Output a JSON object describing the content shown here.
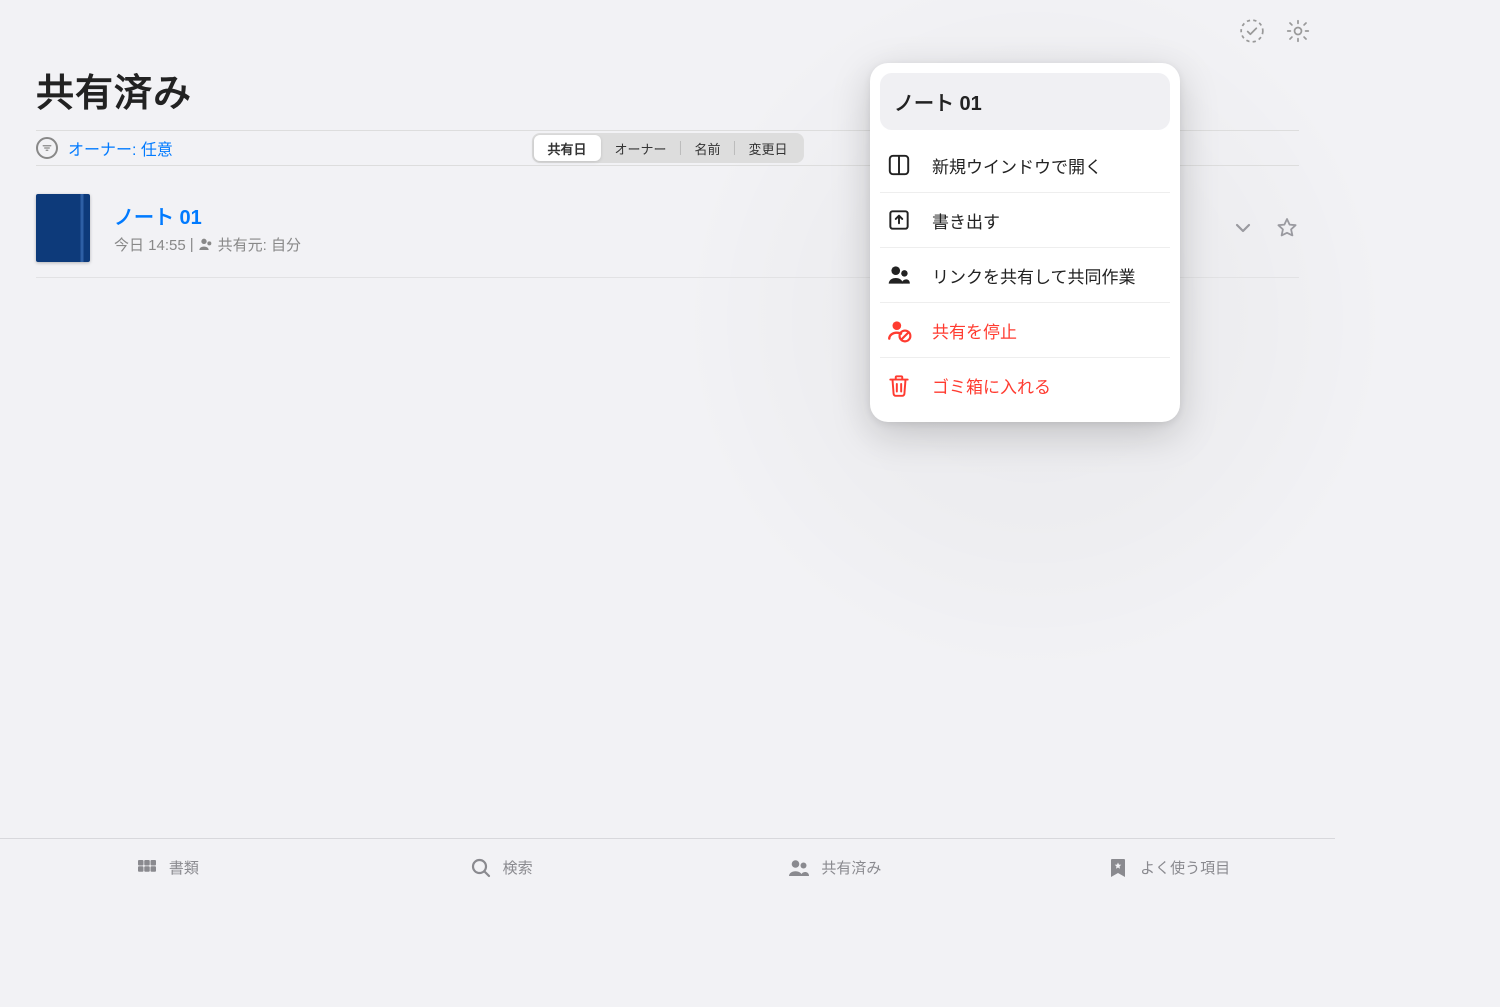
{
  "header": {
    "title": "共有済み"
  },
  "filter": {
    "owner_label": "オーナー: 任意"
  },
  "segmented": {
    "items": [
      {
        "label": "共有日",
        "active": true
      },
      {
        "label": "オーナー",
        "active": false
      },
      {
        "label": "名前",
        "active": false
      },
      {
        "label": "変更日",
        "active": false
      }
    ]
  },
  "note": {
    "name": "ノート 01",
    "timestamp": "今日 14:55",
    "shared_by_label": "共有元: 自分"
  },
  "context_menu": {
    "title": "ノート 01",
    "items": [
      {
        "icon": "new-window",
        "label": "新規ウインドウで開く",
        "danger": false
      },
      {
        "icon": "export",
        "label": "書き出す",
        "danger": false
      },
      {
        "icon": "collaborate",
        "label": "リンクを共有して共同作業",
        "danger": false
      },
      {
        "icon": "stop-share",
        "label": "共有を停止",
        "danger": true
      },
      {
        "icon": "trash",
        "label": "ゴミ箱に入れる",
        "danger": true
      }
    ]
  },
  "tabs": [
    {
      "icon": "grid",
      "label": "書類"
    },
    {
      "icon": "search",
      "label": "検索"
    },
    {
      "icon": "people",
      "label": "共有済み"
    },
    {
      "icon": "bookmark",
      "label": "よく使う項目"
    }
  ]
}
